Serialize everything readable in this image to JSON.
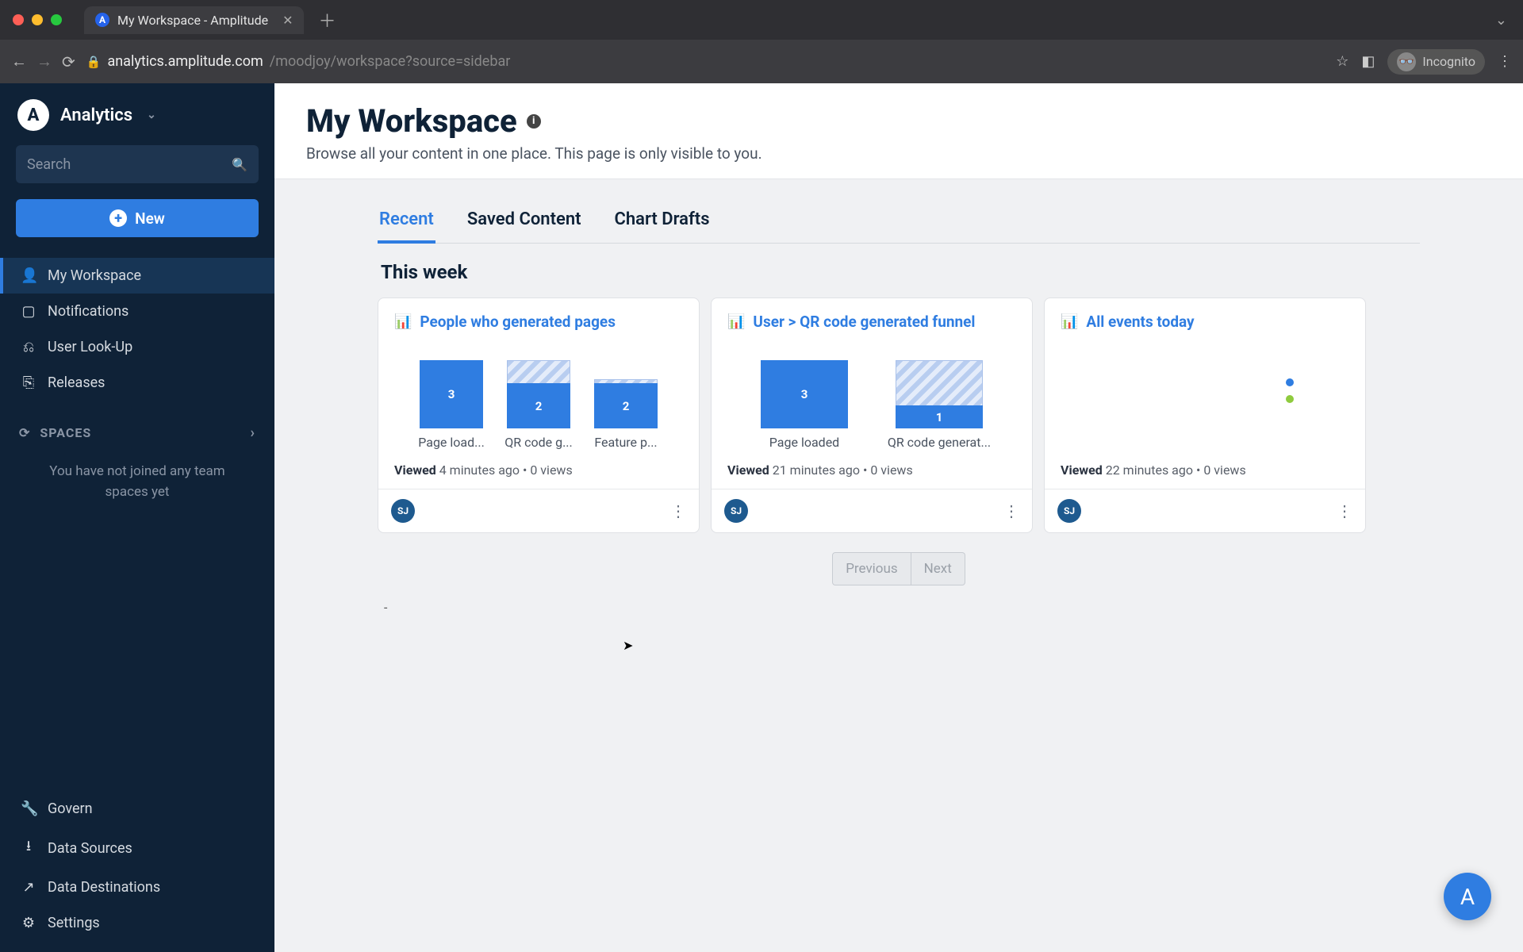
{
  "browser": {
    "tab_title": "My Workspace - Amplitude",
    "url_domain": "analytics.amplitude.com",
    "url_path": "/moodjoy/workspace?source=sidebar",
    "incognito_label": "Incognito"
  },
  "sidebar": {
    "brand": "Analytics",
    "search_placeholder": "Search",
    "new_label": "New",
    "nav": {
      "workspace": "My Workspace",
      "notifications": "Notifications",
      "userlookup": "User Look-Up",
      "releases": "Releases"
    },
    "spaces_label": "SPACES",
    "spaces_empty": "You have not joined any team spaces yet",
    "bottom": {
      "govern": "Govern",
      "sources": "Data Sources",
      "destinations": "Data Destinations",
      "settings": "Settings"
    }
  },
  "page": {
    "title": "My Workspace",
    "subtitle": "Browse all your content in one place. This page is only visible to you."
  },
  "tabs": {
    "recent": "Recent",
    "saved": "Saved Content",
    "drafts": "Chart Drafts"
  },
  "section_title": "This week",
  "cards": [
    {
      "title": "People who generated pages",
      "viewed_label": "Viewed",
      "time": "4 minutes ago",
      "views": "0 views",
      "avatar": "SJ"
    },
    {
      "title": "User > QR code generated funnel",
      "viewed_label": "Viewed",
      "time": "21 minutes ago",
      "views": "0 views",
      "avatar": "SJ"
    },
    {
      "title": "All events today",
      "viewed_label": "Viewed",
      "time": "22 minutes ago",
      "views": "0 views",
      "avatar": "SJ"
    }
  ],
  "pager": {
    "prev": "Previous",
    "next": "Next"
  },
  "chart_data": [
    {
      "type": "bar",
      "categories": [
        "Page load...",
        "QR code g...",
        "Feature p..."
      ],
      "series": [
        {
          "name": "drop",
          "values": [
            0,
            1,
            1
          ]
        },
        {
          "name": "count",
          "values": [
            3,
            2,
            2
          ]
        }
      ]
    },
    {
      "type": "bar",
      "categories": [
        "Page loaded",
        "QR code generat..."
      ],
      "series": [
        {
          "name": "drop",
          "values": [
            0,
            2
          ]
        },
        {
          "name": "count",
          "values": [
            3,
            1
          ]
        }
      ]
    },
    {
      "type": "scatter",
      "points": [
        {
          "color": "#2f7de1",
          "x": 0.78,
          "y": 0.32
        },
        {
          "color": "#8fcb3e",
          "x": 0.78,
          "y": 0.48
        }
      ]
    }
  ]
}
